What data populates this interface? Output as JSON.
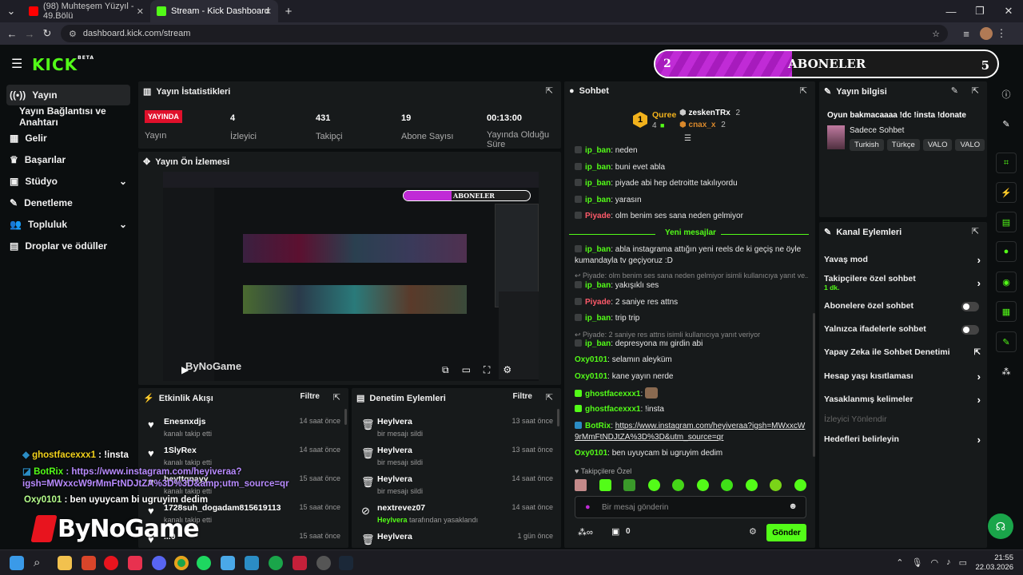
{
  "browser": {
    "tabs": [
      {
        "title": "(98) Muhteşem Yüzyıl - 49.Bölü"
      },
      {
        "title": "Stream - Kick Dashboard"
      }
    ],
    "url": "dashboard.kick.com/stream"
  },
  "header": {
    "logo": "KICK",
    "logo_sup": "BETA",
    "sub_goal": {
      "current": "2",
      "label": "ABONELER",
      "target": "5",
      "progress": 0.4
    }
  },
  "sidebar": {
    "items": [
      {
        "label": "Yayın",
        "icon": "broadcast-icon"
      },
      {
        "label": "Yayın Bağlantısı ve Anahtarı"
      },
      {
        "label": "Gelir",
        "icon": "revenue-icon"
      },
      {
        "label": "Başarılar",
        "icon": "trophy-icon"
      },
      {
        "label": "Stüdyo",
        "icon": "studio-icon"
      },
      {
        "label": "Denetleme",
        "icon": "moderation-icon"
      },
      {
        "label": "Topluluk",
        "icon": "community-icon"
      },
      {
        "label": "Droplar ve ödüller",
        "icon": "gift-icon"
      }
    ]
  },
  "stats": {
    "title": "Yayın İstatistikleri",
    "live_badge": "YAYINDA",
    "items": [
      {
        "value": "",
        "label": "Yayın"
      },
      {
        "value": "4",
        "label": "İzleyici"
      },
      {
        "value": "431",
        "label": "Takipçi"
      },
      {
        "value": "19",
        "label": "Abone Sayısı"
      },
      {
        "value": "00:13:00",
        "label": "Yayında Olduğu Süre"
      }
    ]
  },
  "preview": {
    "title": "Yayın Ön İzlemesi",
    "sub_label": "ABONELER",
    "watermark": "ByNoGame"
  },
  "activity": {
    "title": "Etkinlik Akışı",
    "filter": "Filtre",
    "rows": [
      {
        "name": "Enesnxdjs",
        "sub": "kanalı takip etti",
        "time": "14 saat önce"
      },
      {
        "name": "1SlyRex",
        "sub": "kanalı takip etti",
        "time": "14 saat önce"
      },
      {
        "name": "beyttgnayy",
        "sub": "kanalı takip etti",
        "time": "15 saat önce"
      },
      {
        "name": "1728suh_dogadam815619113",
        "sub": "kanalı takip etti",
        "time": "15 saat önce"
      },
      {
        "name": "...0",
        "sub": "",
        "time": "15 saat önce"
      }
    ]
  },
  "modlog": {
    "title": "Denetim Eylemleri",
    "filter": "Filtre",
    "rows": [
      {
        "name": "Heylvera",
        "sub": "bir mesajı sildi",
        "time": "13 saat önce"
      },
      {
        "name": "Heylvera",
        "sub": "bir mesajı sildi",
        "time": "13 saat önce"
      },
      {
        "name": "Heylvera",
        "sub": "bir mesajı sildi",
        "time": "14 saat önce"
      },
      {
        "name": "nextrevez07",
        "sub": "tarafından yasaklandı",
        "sub_user": "Heylvera",
        "time": "14 saat önce"
      },
      {
        "name": "Heylvera",
        "sub": "",
        "time": "1 gün önce"
      }
    ]
  },
  "chat": {
    "title": "Sohbet",
    "leaderboard": [
      {
        "name": "Quree",
        "count": "4"
      },
      {
        "name": "zeskenTRx",
        "count": "2"
      },
      {
        "name": "cnax_x",
        "count": "2"
      }
    ],
    "new_messages": "Yeni mesajlar",
    "messages": [
      {
        "user": "ip_ban",
        "text": "neden",
        "color": "green"
      },
      {
        "user": "ip_ban",
        "text": "buni evet abla",
        "color": "green"
      },
      {
        "user": "ip_ban",
        "text": "piyade abi hep detroitte takılıyordu",
        "color": "green"
      },
      {
        "user": "ip_ban",
        "text": "yarasın",
        "color": "green"
      },
      {
        "user": "Piyade",
        "text": "olm benim ses sana neden gelmiyor",
        "color": "red"
      },
      {
        "user": "ip_ban",
        "text": "abla instagrama attığın yeni reels de ki geçiş ne öyle kumandayla tv geçiyoruz :D",
        "color": "green"
      },
      {
        "reply": "Piyade: olm benim ses sana neden gelmiyor isimli kullanıcıya yanıt ve..."
      },
      {
        "user": "ip_ban",
        "text": "yakışıklı ses",
        "color": "green"
      },
      {
        "user": "Piyade",
        "text": "2 saniye res attns",
        "color": "red"
      },
      {
        "user": "ip_ban",
        "text": "trip trip",
        "color": "green"
      },
      {
        "reply": "Piyade: 2 saniye res attns isimli kullanıcıya yanıt veriyor"
      },
      {
        "user": "ip_ban",
        "text": "depresyona mı girdin abi",
        "color": "green"
      },
      {
        "user": "Oxy0101",
        "text": "selamın aleyküm",
        "color": "green"
      },
      {
        "user": "Oxy0101",
        "text": "kane yayın nerde",
        "color": "green"
      },
      {
        "user": "ghostfacexxx1",
        "text": "",
        "color": "green"
      },
      {
        "user": "ghostfacexxx1",
        "text": "!insta",
        "color": "green"
      },
      {
        "user": "BotRix",
        "text": "https://www.instagram.com/heyiveraa?igsh=MWxxcW9rMmFtNDJtZA%3D%3D&utm_source=qr",
        "color": "green"
      },
      {
        "user": "Oxy0101",
        "text": "ben uyuycam bi ugruyim dedim",
        "color": "green"
      }
    ],
    "followers_only": "Takipçilere Özel",
    "placeholder": "Bir mesaj gönderin",
    "points": "0",
    "send": "Gönder"
  },
  "streaminfo": {
    "title": "Yayın bilgisi",
    "stream_title": "Oyun bakmacaaaa !dc !insta !donate",
    "category": "Sadece Sohbet",
    "tags": [
      "Turkish",
      "Türkçe",
      "VALO",
      "VALO"
    ]
  },
  "channel_actions": {
    "title": "Kanal Eylemleri",
    "items": [
      {
        "label": "Yavaş mod",
        "kind": "arrow"
      },
      {
        "label": "Takipçilere özel sohbet",
        "sub": "1 dk.",
        "kind": "arrow"
      },
      {
        "label": "Abonelere özel sohbet",
        "kind": "toggle"
      },
      {
        "label": "Yalnızca ifadelerle sohbet",
        "kind": "toggle"
      },
      {
        "label": "Yapay Zeka ile Sohbet Denetimi",
        "kind": "external"
      },
      {
        "label": "Hesap yaşı kısıtlaması",
        "kind": "arrow"
      },
      {
        "label": "Yasaklanmış kelimeler",
        "kind": "arrow"
      },
      {
        "label": "İzleyici Yönlendir",
        "kind": "disabled"
      },
      {
        "label": "Hedefleri belirleyin",
        "kind": "arrow"
      }
    ]
  },
  "overlay": {
    "line1_user": "ghostfacexxx1",
    "line1_text": ": !insta",
    "line2_user": "BotRix",
    "line2_text": ": https://www.instagram.com/heyiveraa?",
    "line3_text": "igsh=MWxxcW9rMmFtNDJtZA%3D%3D&amp;utm_source=qr",
    "line4_user": "Oxy0101",
    "line4_text": ": ben uyuycam bi ugruyim dedim",
    "brand": "ByNoGame"
  },
  "taskbar": {
    "time": "21:55",
    "date": "22.03.2026"
  },
  "colors": {
    "kick_green": "#53fc18",
    "live_red": "#e0102b",
    "sub_purple": "#c02bd6"
  }
}
